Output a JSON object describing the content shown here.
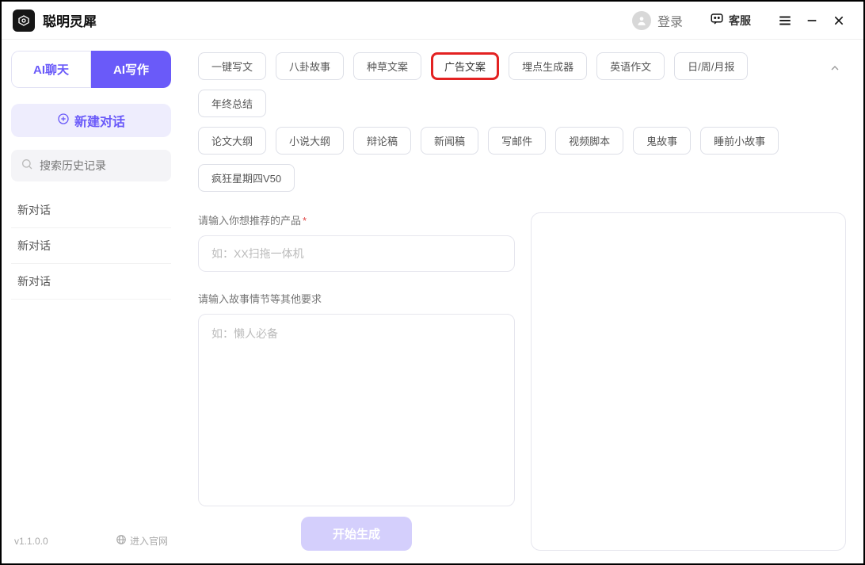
{
  "titlebar": {
    "appName": "聪明灵犀",
    "login": "登录",
    "kefu": "客服"
  },
  "sidebar": {
    "modeChat": "AI聊天",
    "modeWrite": "AI写作",
    "newChat": "新建对话",
    "searchPlaceholder": "搜索历史记录",
    "history": [
      "新对话",
      "新对话",
      "新对话"
    ],
    "version": "v1.1.0.0",
    "enterSite": "进入官网"
  },
  "tags": {
    "row1": [
      "一键写文",
      "八卦故事",
      "种草文案",
      "广告文案",
      "埋点生成器",
      "英语作文",
      "日/周/月报",
      "年终总结"
    ],
    "row2": [
      "论文大纲",
      "小说大纲",
      "辩论稿",
      "新闻稿",
      "写邮件",
      "视频脚本",
      "鬼故事",
      "睡前小故事",
      "疯狂星期四V50"
    ],
    "selected": "广告文案"
  },
  "form": {
    "productLabel": "请输入你想推荐的产品",
    "productPlaceholder": "如：XX扫拖一体机",
    "extraLabel": "请输入故事情节等其他要求",
    "extraPlaceholder": "如：懒人必备",
    "generate": "开始生成"
  }
}
